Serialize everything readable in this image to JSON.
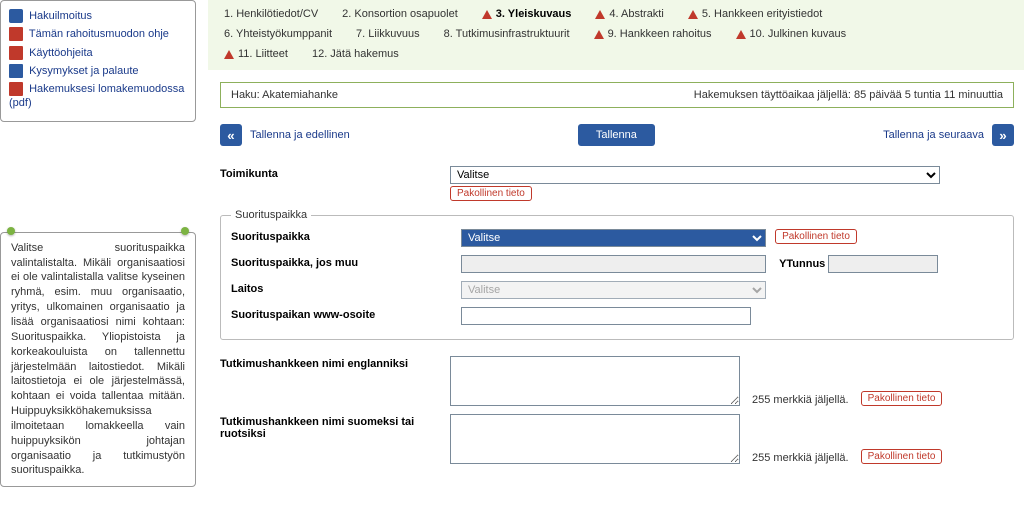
{
  "sidebar": {
    "links": [
      {
        "label": "Hakuilmoitus",
        "icon": "search-icon"
      },
      {
        "label": "Tämän rahoitusmuodon ohje",
        "icon": "pdf-icon"
      },
      {
        "label": "Käyttöohjeita",
        "icon": "pdf-icon"
      },
      {
        "label": "Kysymykset ja palaute",
        "icon": "mail-icon"
      },
      {
        "label": "Hakemuksesi lomakemuodossa (pdf)",
        "icon": "pdf-icon"
      }
    ],
    "help_text": "Valitse suorituspaikka valintalistalta. Mikäli organisaatiosi ei ole valintalistalla valitse kyseinen ryhmä, esim. muu organisaatio, yritys, ulkomainen organisaatio ja lisää organisaatiosi nimi kohtaan: Suorituspaikka. Yliopistoista ja korkeakouluista on tallennettu järjestelmään laitostiedot. Mikäli laitostietoja ei ole järjestelmässä, kohtaan ei voida tallentaa mitään. Huippuyksikköhakemuksissa ilmoitetaan lomakkeella vain huippuyksikön johtajan organisaatio ja tutkimustyön suorituspaikka."
  },
  "tabs": [
    {
      "label": "1. Henkilötiedot/CV",
      "warn": false,
      "active": false
    },
    {
      "label": "2. Konsortion osapuolet",
      "warn": false,
      "active": false
    },
    {
      "label": "3. Yleiskuvaus",
      "warn": true,
      "active": true
    },
    {
      "label": "4. Abstrakti",
      "warn": true,
      "active": false
    },
    {
      "label": "5. Hankkeen erityistiedot",
      "warn": true,
      "active": false
    },
    {
      "label": "6. Yhteistyökumppanit",
      "warn": false,
      "active": false
    },
    {
      "label": "7. Liikkuvuus",
      "warn": false,
      "active": false
    },
    {
      "label": "8. Tutkimusinfrastruktuurit",
      "warn": false,
      "active": false
    },
    {
      "label": "9. Hankkeen rahoitus",
      "warn": true,
      "active": false
    },
    {
      "label": "10. Julkinen kuvaus",
      "warn": true,
      "active": false
    },
    {
      "label": "11. Liitteet",
      "warn": true,
      "active": false
    },
    {
      "label": "12. Jätä hakemus",
      "warn": false,
      "active": false
    }
  ],
  "status": {
    "haku_label": "Haku: Akatemiahanke",
    "time_left": "Hakemuksen täyttöaikaa jäljellä: 85 päivää 5 tuntia 11 minuuttia"
  },
  "buttons": {
    "prev_arrow": "«",
    "prev_label": "Tallenna ja edellinen",
    "save": "Tallenna",
    "next_label": "Tallenna ja seuraava",
    "next_arrow": "»"
  },
  "form": {
    "required_badge": "Pakollinen tieto",
    "toimikunta_label": "Toimikunta",
    "toimikunta_value": "Valitse",
    "suorituspaikka_legend": "Suorituspaikka",
    "suorituspaikka_label": "Suorituspaikka",
    "suorituspaikka_value": "Valitse",
    "suorituspaikka_muu_label": "Suorituspaikka, jos muu",
    "ytunnus_label": "YTunnus",
    "laitos_label": "Laitos",
    "laitos_value": "Valitse",
    "www_label": "Suorituspaikan www-osoite",
    "nimi_en_label": "Tutkimushankkeen nimi englanniksi",
    "nimi_fi_label": "Tutkimushankkeen nimi suomeksi tai ruotsiksi",
    "chars_left_en": "255 merkkiä jäljellä.",
    "chars_left_fi": "255 merkkiä jäljellä."
  }
}
